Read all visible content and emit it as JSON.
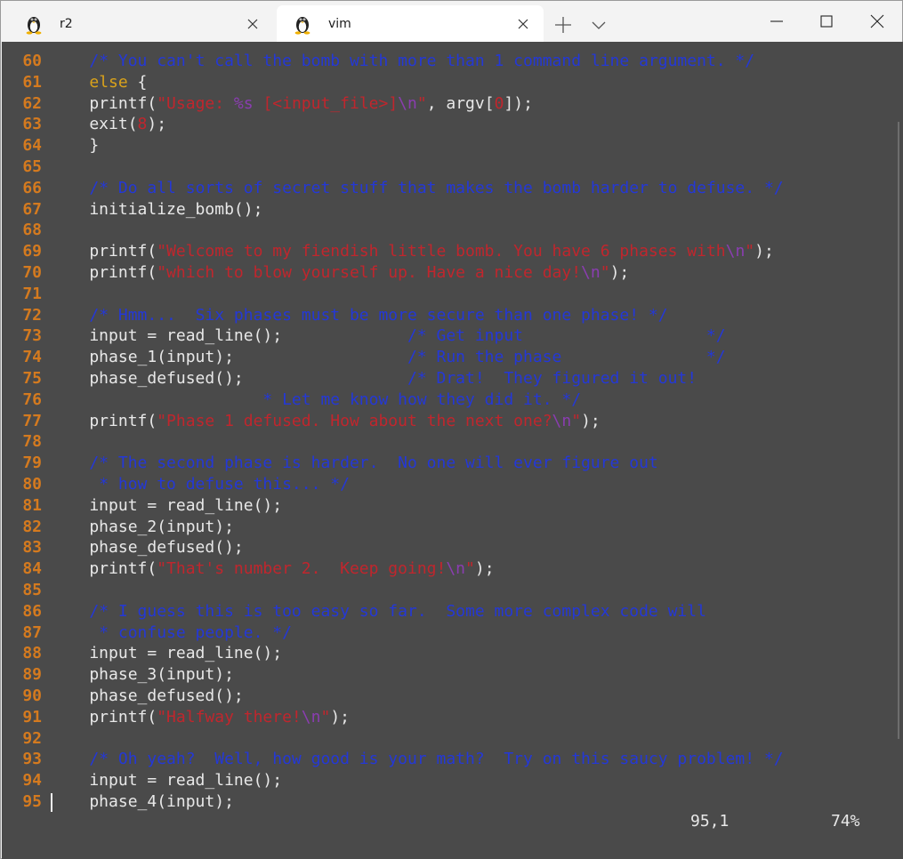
{
  "tabs": [
    {
      "label": "r2",
      "active": false,
      "icon": "tux-icon"
    },
    {
      "label": "vim",
      "active": true,
      "icon": "tux-icon"
    }
  ],
  "colors": {
    "background": "#4a4a4a",
    "line_number": "#d47a1f",
    "comment": "#2438d6",
    "string": "#c0262d",
    "escape": "#8a3db0",
    "keyword": "#d9a21b",
    "text": "#e8e8e8"
  },
  "editor": {
    "lines": [
      {
        "num": "60",
        "segments": [
          {
            "t": "    ",
            "c": "def"
          },
          {
            "t": "/* You can't call the bomb with more than 1 command line argument. */",
            "c": "com"
          }
        ]
      },
      {
        "num": "61",
        "segments": [
          {
            "t": "    ",
            "c": "def"
          },
          {
            "t": "else",
            "c": "key"
          },
          {
            "t": " {",
            "c": "def"
          }
        ]
      },
      {
        "num": "62",
        "segments": [
          {
            "t": "    printf(",
            "c": "def"
          },
          {
            "t": "\"Usage: ",
            "c": "str"
          },
          {
            "t": "%s",
            "c": "esc"
          },
          {
            "t": " [<input_file>]",
            "c": "str"
          },
          {
            "t": "\\n",
            "c": "esc"
          },
          {
            "t": "\"",
            "c": "str"
          },
          {
            "t": ", argv[",
            "c": "def"
          },
          {
            "t": "0",
            "c": "str"
          },
          {
            "t": "]);",
            "c": "def"
          }
        ]
      },
      {
        "num": "63",
        "segments": [
          {
            "t": "    exit(",
            "c": "def"
          },
          {
            "t": "8",
            "c": "str"
          },
          {
            "t": ");",
            "c": "def"
          }
        ]
      },
      {
        "num": "64",
        "segments": [
          {
            "t": "    }",
            "c": "def"
          }
        ]
      },
      {
        "num": "65",
        "segments": []
      },
      {
        "num": "66",
        "segments": [
          {
            "t": "    ",
            "c": "def"
          },
          {
            "t": "/* Do all sorts of secret stuff that makes the bomb harder to defuse. */",
            "c": "com"
          }
        ]
      },
      {
        "num": "67",
        "segments": [
          {
            "t": "    initialize_bomb();",
            "c": "def"
          }
        ]
      },
      {
        "num": "68",
        "segments": []
      },
      {
        "num": "69",
        "segments": [
          {
            "t": "    printf(",
            "c": "def"
          },
          {
            "t": "\"Welcome to my fiendish little bomb. You have 6 phases with",
            "c": "str"
          },
          {
            "t": "\\n",
            "c": "esc"
          },
          {
            "t": "\"",
            "c": "str"
          },
          {
            "t": ");",
            "c": "def"
          }
        ]
      },
      {
        "num": "70",
        "segments": [
          {
            "t": "    printf(",
            "c": "def"
          },
          {
            "t": "\"which to blow yourself up. Have a nice day!",
            "c": "str"
          },
          {
            "t": "\\n",
            "c": "esc"
          },
          {
            "t": "\"",
            "c": "str"
          },
          {
            "t": ");",
            "c": "def"
          }
        ]
      },
      {
        "num": "71",
        "segments": []
      },
      {
        "num": "72",
        "segments": [
          {
            "t": "    ",
            "c": "def"
          },
          {
            "t": "/* Hmm...  Six phases must be more secure than one phase! */",
            "c": "com"
          }
        ]
      },
      {
        "num": "73",
        "segments": [
          {
            "t": "    input = read_line();             ",
            "c": "def"
          },
          {
            "t": "/* Get input                   */",
            "c": "com"
          }
        ]
      },
      {
        "num": "74",
        "segments": [
          {
            "t": "    phase_1(input);                  ",
            "c": "def"
          },
          {
            "t": "/* Run the phase               */",
            "c": "com"
          }
        ]
      },
      {
        "num": "75",
        "segments": [
          {
            "t": "    phase_defused();                 ",
            "c": "def"
          },
          {
            "t": "/* Drat!  They figured it out!",
            "c": "com"
          }
        ]
      },
      {
        "num": "76",
        "segments": [
          {
            "t": "                      ",
            "c": "def"
          },
          {
            "t": "* Let me know how they did it. */",
            "c": "com"
          }
        ]
      },
      {
        "num": "77",
        "segments": [
          {
            "t": "    printf(",
            "c": "def"
          },
          {
            "t": "\"Phase 1 defused. How about the next one?",
            "c": "str"
          },
          {
            "t": "\\n",
            "c": "esc"
          },
          {
            "t": "\"",
            "c": "str"
          },
          {
            "t": ");",
            "c": "def"
          }
        ]
      },
      {
        "num": "78",
        "segments": []
      },
      {
        "num": "79",
        "segments": [
          {
            "t": "    ",
            "c": "def"
          },
          {
            "t": "/* The second phase is harder.  No one will ever figure out",
            "c": "com"
          }
        ]
      },
      {
        "num": "80",
        "segments": [
          {
            "t": "     ",
            "c": "def"
          },
          {
            "t": "* how to defuse this... */",
            "c": "com"
          }
        ]
      },
      {
        "num": "81",
        "segments": [
          {
            "t": "    input = read_line();",
            "c": "def"
          }
        ]
      },
      {
        "num": "82",
        "segments": [
          {
            "t": "    phase_2(input);",
            "c": "def"
          }
        ]
      },
      {
        "num": "83",
        "segments": [
          {
            "t": "    phase_defused();",
            "c": "def"
          }
        ]
      },
      {
        "num": "84",
        "segments": [
          {
            "t": "    printf(",
            "c": "def"
          },
          {
            "t": "\"That's number 2.  Keep going!",
            "c": "str"
          },
          {
            "t": "\\n",
            "c": "esc"
          },
          {
            "t": "\"",
            "c": "str"
          },
          {
            "t": ");",
            "c": "def"
          }
        ]
      },
      {
        "num": "85",
        "segments": []
      },
      {
        "num": "86",
        "segments": [
          {
            "t": "    ",
            "c": "def"
          },
          {
            "t": "/* I guess this is too easy so far.  Some more complex code will",
            "c": "com"
          }
        ]
      },
      {
        "num": "87",
        "segments": [
          {
            "t": "     ",
            "c": "def"
          },
          {
            "t": "* confuse people. */",
            "c": "com"
          }
        ]
      },
      {
        "num": "88",
        "segments": [
          {
            "t": "    input = read_line();",
            "c": "def"
          }
        ]
      },
      {
        "num": "89",
        "segments": [
          {
            "t": "    phase_3(input);",
            "c": "def"
          }
        ]
      },
      {
        "num": "90",
        "segments": [
          {
            "t": "    phase_defused();",
            "c": "def"
          }
        ]
      },
      {
        "num": "91",
        "segments": [
          {
            "t": "    printf(",
            "c": "def"
          },
          {
            "t": "\"Halfway there!",
            "c": "str"
          },
          {
            "t": "\\n",
            "c": "esc"
          },
          {
            "t": "\"",
            "c": "str"
          },
          {
            "t": ");",
            "c": "def"
          }
        ]
      },
      {
        "num": "92",
        "segments": []
      },
      {
        "num": "93",
        "segments": [
          {
            "t": "    ",
            "c": "def"
          },
          {
            "t": "/* Oh yeah?  Well, how good is your math?  Try on this saucy problem! */",
            "c": "com"
          }
        ]
      },
      {
        "num": "94",
        "segments": [
          {
            "t": "    input = read_line();",
            "c": "def"
          }
        ]
      },
      {
        "num": "95",
        "segments": [
          {
            "t": "    phase_4(input);",
            "c": "def"
          }
        ]
      }
    ]
  },
  "status": {
    "position": "95,1",
    "percent": "74%"
  }
}
